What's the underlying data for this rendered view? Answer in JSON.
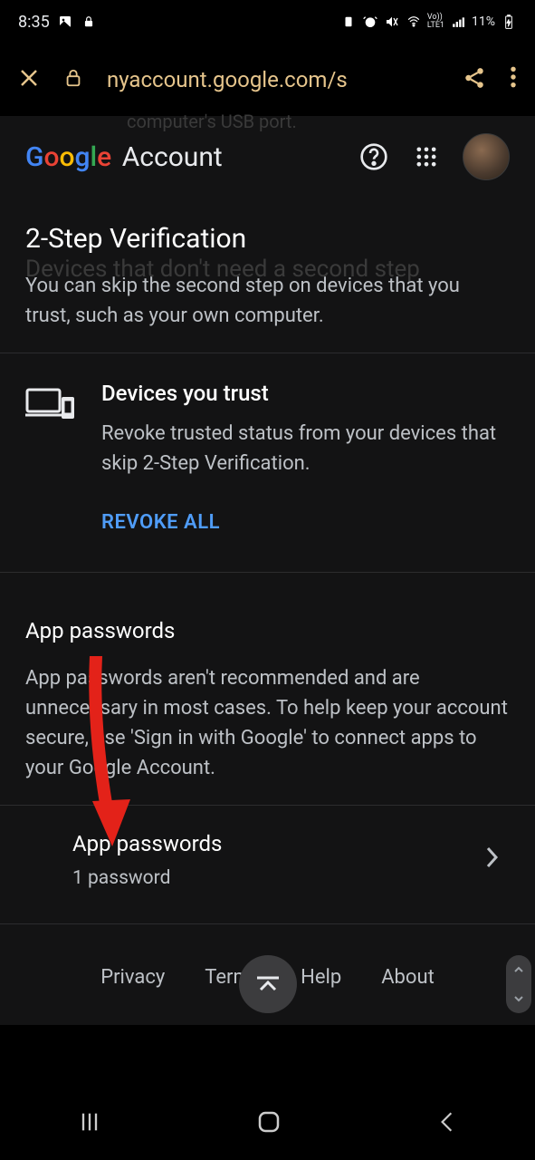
{
  "statusbar": {
    "time": "8:35",
    "battery": "11%"
  },
  "browser": {
    "url": "nyaccount.google.com/s"
  },
  "header": {
    "logo_g1": "G",
    "logo_o1": "o",
    "logo_o2": "o",
    "logo_g2": "g",
    "logo_l": "l",
    "logo_e": "e",
    "account_word": "Account"
  },
  "page": {
    "title": "2-Step Verification",
    "ghost_usb": "computer's USB port.",
    "ghost_devices": "Devices that don't need a second step",
    "intro": "You can skip the second step on devices that you trust, such as your own computer."
  },
  "trust_card": {
    "title": "Devices you trust",
    "text": "Revoke trusted status from your devices that skip 2-Step Verification.",
    "button": "REVOKE ALL"
  },
  "app_passwords": {
    "heading": "App passwords",
    "desc": "App passwords aren't recommended and are unnecessary in most cases. To help keep your account secure, use 'Sign in with Google' to connect apps to your Google Account.",
    "item_title": "App passwords",
    "item_sub": "1 password"
  },
  "footer": {
    "privacy": "Privacy",
    "terms": "Terms",
    "help": "Help",
    "about": "About"
  }
}
